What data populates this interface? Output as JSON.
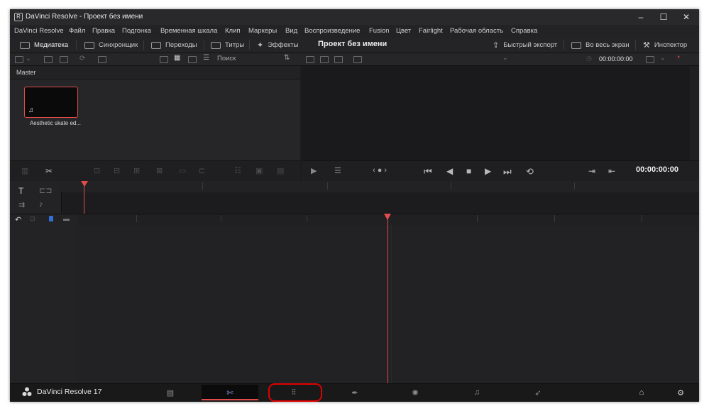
{
  "window": {
    "title": "DaVinci Resolve - Проект без имени",
    "app_icon": "R",
    "controls": [
      "–",
      "☐",
      "✕"
    ]
  },
  "menu": [
    "DaVinci Resolve",
    "Файл",
    "Правка",
    "Подгонка",
    "Временная шкала",
    "Клип",
    "Маркеры",
    "Вид",
    "Воспроизведение",
    "Fusion",
    "Цвет",
    "Fairlight",
    "Рабочая область",
    "Справка"
  ],
  "toolbar": {
    "media": "Медиатека",
    "sync": "Синхронщик",
    "transitions": "Переходы",
    "titles": "Титры",
    "effects": "Эффекты",
    "project_title": "Проект без имени",
    "quick_export": "Быстрый экспорт",
    "fullscreen": "Во весь экран",
    "inspector": "Инспектор"
  },
  "subbar": {
    "search": "Поиск",
    "timecode": "00:00:00:00"
  },
  "media_pool": {
    "bin": "Master",
    "clips": [
      {
        "name": "Aesthetic skate ed...",
        "icon": "music-note-icon"
      }
    ]
  },
  "viewer": {
    "timecode": "00:00:00:00"
  },
  "bottom_bar": {
    "app_name": "DaVinci Resolve 17",
    "pages": [
      "media",
      "cut",
      "edit",
      "fusion",
      "color",
      "fairlight",
      "deliver"
    ],
    "active_page": "cut",
    "highlighted_page": "edit"
  },
  "colors": {
    "accent": "#e24b4b",
    "highlight": "#e00000",
    "background": "#1c1c1e"
  }
}
